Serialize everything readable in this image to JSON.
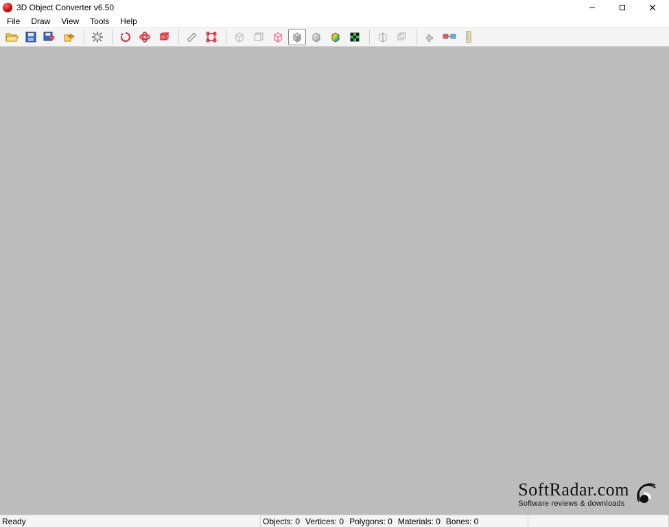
{
  "window": {
    "title": "3D Object Converter v6.50"
  },
  "menu": {
    "items": [
      "File",
      "Draw",
      "View",
      "Tools",
      "Help"
    ]
  },
  "toolbar": {
    "groups": [
      [
        "open",
        "save",
        "save-config",
        "export"
      ],
      [
        "options"
      ],
      [
        "rotate-x",
        "rotate-freely",
        "rotate-y"
      ],
      [
        "bones-tool",
        "joints-tool"
      ],
      [
        "wireframe-left",
        "wireframe-front",
        "wireframe-red",
        "flat-shade",
        "smooth-shade",
        "color-gradient",
        "checker-texture"
      ],
      [
        "flip-normals",
        "double-sided"
      ],
      [
        "tool-plugin",
        "glasses-3d",
        "measure"
      ]
    ],
    "selected": "flat-shade"
  },
  "status": {
    "ready": "Ready",
    "objects_label": "Objects:",
    "objects": 0,
    "vertices_label": "Vertices:",
    "vertices": 0,
    "polygons_label": "Polygons:",
    "polygons": 0,
    "materials_label": "Materials:",
    "materials": 0,
    "bones_label": "Bones:",
    "bones": 0
  },
  "watermark": {
    "title": "SoftRadar.com",
    "subtitle": "Software reviews & downloads"
  }
}
